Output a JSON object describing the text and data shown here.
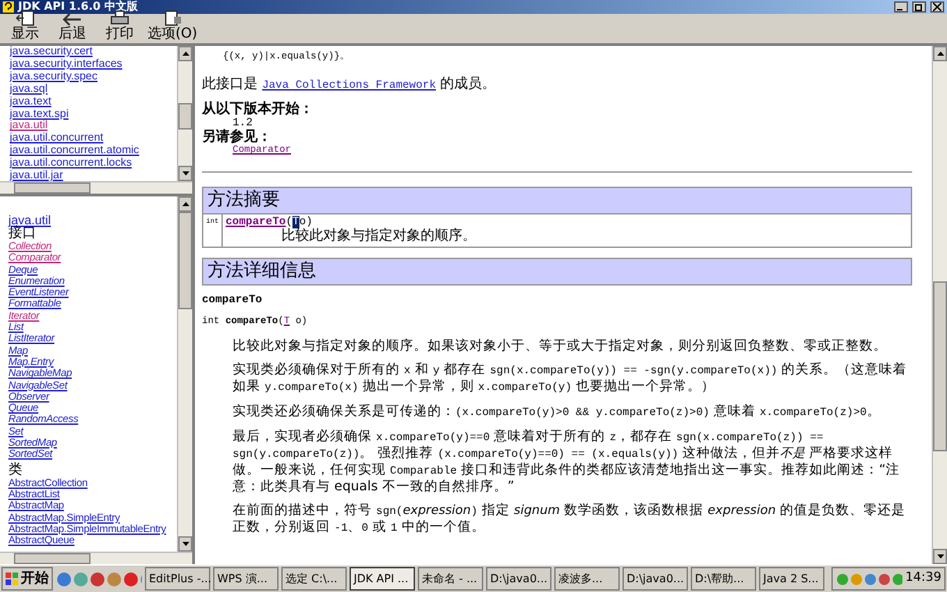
{
  "window": {
    "title": "JDK API 1.6.0 中文版"
  },
  "toolbar": [
    {
      "label": "显示",
      "kind": "show"
    },
    {
      "label": "后退",
      "kind": "back"
    },
    {
      "label": "打印",
      "kind": "print"
    },
    {
      "label": "选项(O)",
      "kind": "options"
    }
  ],
  "packages": [
    {
      "label": "java.security.cert",
      "visited": false
    },
    {
      "label": "java.security.interfaces",
      "visited": false
    },
    {
      "label": "java.security.spec",
      "visited": false
    },
    {
      "label": "java.sql",
      "visited": false
    },
    {
      "label": "java.text",
      "visited": false
    },
    {
      "label": "java.text.spi",
      "visited": false
    },
    {
      "label": "java.util",
      "visited": true
    },
    {
      "label": "java.util.concurrent",
      "visited": false
    },
    {
      "label": "java.util.concurrent.atomic",
      "visited": false
    },
    {
      "label": "java.util.concurrent.locks",
      "visited": false
    },
    {
      "label": "java.util.jar",
      "visited": false
    }
  ],
  "package_frame": {
    "title": "java.util",
    "sections": [
      {
        "heading": "接口",
        "kind": "interface",
        "items": [
          {
            "label": "Collection",
            "visited": true
          },
          {
            "label": "Comparator",
            "visited": true
          },
          {
            "label": "Deque",
            "visited": false
          },
          {
            "label": "Enumeration",
            "visited": false
          },
          {
            "label": "EventListener",
            "visited": false
          },
          {
            "label": "Formattable",
            "visited": false
          },
          {
            "label": "Iterator",
            "visited": true
          },
          {
            "label": "List",
            "visited": false
          },
          {
            "label": "ListIterator",
            "visited": false
          },
          {
            "label": "Map",
            "visited": false
          },
          {
            "label": "Map.Entry",
            "visited": false
          },
          {
            "label": "NavigableMap",
            "visited": false
          },
          {
            "label": "NavigableSet",
            "visited": false
          },
          {
            "label": "Observer",
            "visited": false
          },
          {
            "label": "Queue",
            "visited": false
          },
          {
            "label": "RandomAccess",
            "visited": false
          },
          {
            "label": "Set",
            "visited": false
          },
          {
            "label": "SortedMap",
            "visited": false
          },
          {
            "label": "SortedSet",
            "visited": false
          }
        ]
      },
      {
        "heading": "类",
        "kind": "class",
        "items": [
          {
            "label": "AbstractCollection",
            "visited": false
          },
          {
            "label": "AbstractList",
            "visited": false
          },
          {
            "label": "AbstractMap",
            "visited": false
          },
          {
            "label": "AbstractMap.SimpleEntry",
            "visited": false
          },
          {
            "label": "AbstractMap.SimpleImmutableEntry",
            "visited": false
          },
          {
            "label": "AbstractQueue",
            "visited": false
          }
        ]
      }
    ]
  },
  "doc": {
    "top_code": "{(x, y)|x.equals(y)}。",
    "member_prefix": "此接口是",
    "member_link": "Java Collections Framework",
    "member_suffix": "的成员。",
    "since_label": "从以下版本开始：",
    "since_value": "1.2",
    "see_label": "另请参见：",
    "see_link": "Comparator",
    "summary": {
      "title": "方法摘要",
      "type": "int",
      "method": "compareTo",
      "param_open": "(",
      "param_type": "T",
      "param_name": "o)",
      "description": "比较此对象与指定对象的顺序。"
    },
    "detail": {
      "title": "方法详细信息",
      "method_name": "compareTo",
      "signature": [
        {
          "kind": "text",
          "text": "int "
        },
        {
          "kind": "bold",
          "text": "compareTo"
        },
        {
          "kind": "text",
          "text": "("
        },
        {
          "kind": "link",
          "text": "T"
        },
        {
          "kind": "text",
          "text": " o)"
        }
      ],
      "paragraphs": [
        [
          {
            "kind": "text",
            "text": "比较此对象与指定对象的顺序。如果该对象小于、等于或大于指定对象，则分别返回负整数、零或正整数。"
          }
        ],
        [
          {
            "kind": "text",
            "text": "实现类必须确保对于所有的 "
          },
          {
            "kind": "code",
            "text": "x"
          },
          {
            "kind": "text",
            "text": " 和 "
          },
          {
            "kind": "code",
            "text": "y"
          },
          {
            "kind": "text",
            "text": " 都存在 "
          },
          {
            "kind": "code",
            "text": "sgn(x.compareTo(y)) == -sgn(y.compareTo(x))"
          },
          {
            "kind": "text",
            "text": " 的关系。（这意味着如果 "
          },
          {
            "kind": "code",
            "text": "y.compareTo(x)"
          },
          {
            "kind": "text",
            "text": " 抛出一个异常，则 "
          },
          {
            "kind": "code",
            "text": "x.compareTo(y)"
          },
          {
            "kind": "text",
            "text": " 也要抛出一个异常。）"
          }
        ],
        [
          {
            "kind": "text",
            "text": "实现类还必须确保关系是可传递的："
          },
          {
            "kind": "code",
            "text": "(x.compareTo(y)>0 && y.compareTo(z)>0)"
          },
          {
            "kind": "text",
            "text": " 意味着 "
          },
          {
            "kind": "code",
            "text": "x.compareTo(z)>0"
          },
          {
            "kind": "text",
            "text": "。"
          }
        ],
        [
          {
            "kind": "text",
            "text": "最后，实现者必须确保 "
          },
          {
            "kind": "code",
            "text": "x.compareTo(y)==0"
          },
          {
            "kind": "text",
            "text": " 意味着对于所有的 "
          },
          {
            "kind": "code",
            "text": "z"
          },
          {
            "kind": "text",
            "text": "，都存在 "
          },
          {
            "kind": "code",
            "text": "sgn(x.compareTo(z)) == sgn(y.compareTo(z))"
          },
          {
            "kind": "text",
            "text": "。 强烈推荐 "
          },
          {
            "kind": "code",
            "text": "(x.compareTo(y)==0) == (x.equals(y))"
          },
          {
            "kind": "text",
            "text": " 这种做法，但并"
          },
          {
            "kind": "italic",
            "text": "不是"
          },
          {
            "kind": "text",
            "text": " 严格要求这样做。一般来说，任何实现 "
          },
          {
            "kind": "code",
            "text": "Comparable"
          },
          {
            "kind": "text",
            "text": " 接口和违背此条件的类都应该清楚地指出这一事实。推荐如此阐述：“注意：此类具有与 equals 不一致的自然排序。”"
          }
        ],
        [
          {
            "kind": "text",
            "text": "在前面的描述中，符号 "
          },
          {
            "kind": "code",
            "text": "sgn("
          },
          {
            "kind": "italic",
            "text": "expression"
          },
          {
            "kind": "code",
            "text": ")"
          },
          {
            "kind": "text",
            "text": " 指定 "
          },
          {
            "kind": "italic",
            "text": "signum"
          },
          {
            "kind": "text",
            "text": " 数学函数，该函数根据 "
          },
          {
            "kind": "italic",
            "text": "expression"
          },
          {
            "kind": "text",
            "text": " 的值是负数、零还是正数，分别返回 "
          },
          {
            "kind": "code",
            "text": "-1"
          },
          {
            "kind": "text",
            "text": "、"
          },
          {
            "kind": "code",
            "text": "0"
          },
          {
            "kind": "text",
            "text": " 或 "
          },
          {
            "kind": "code",
            "text": "1"
          },
          {
            "kind": "text",
            "text": " 中的一个值。"
          }
        ]
      ]
    }
  },
  "taskbar": {
    "start": "开始",
    "tasks": [
      {
        "label": "EditPlus -...",
        "selected": false
      },
      {
        "label": "WPS 演...",
        "selected": false
      },
      {
        "label": "选定 C:\\...",
        "selected": false
      },
      {
        "label": "JDK API ...",
        "selected": true
      },
      {
        "label": "未命名 - ...",
        "selected": false
      },
      {
        "label": "D:\\java0...",
        "selected": false
      },
      {
        "label": "凌波多...",
        "selected": false
      },
      {
        "label": "D:\\java0...",
        "selected": false
      },
      {
        "label": "D:\\帮助...",
        "selected": false
      },
      {
        "label": "Java 2 S...",
        "selected": false
      }
    ],
    "clock": "14:39"
  }
}
